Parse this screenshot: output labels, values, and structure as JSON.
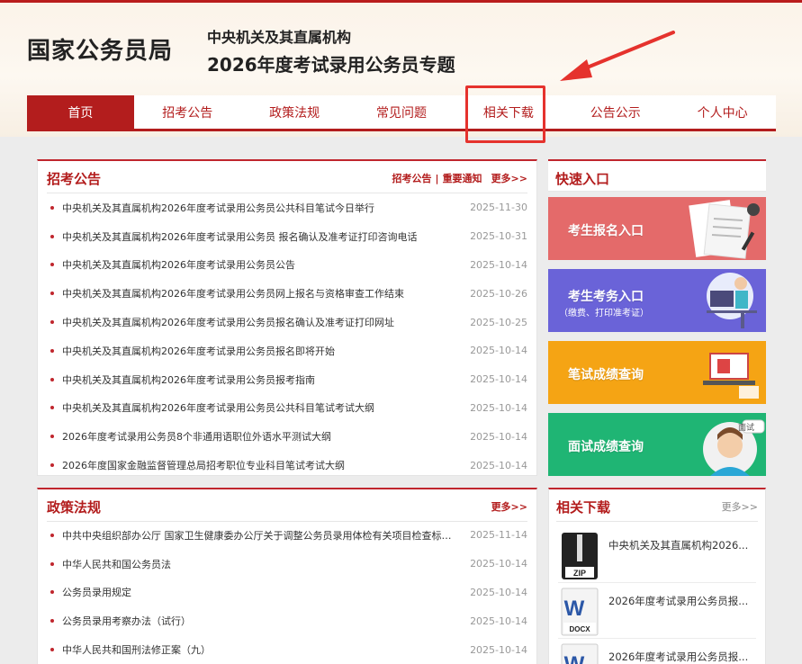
{
  "header": {
    "logo": "国家公务员局",
    "subtitle_line1": "中央机关及其直属机构",
    "subtitle_line2": "2026年度考试录用公务员专题"
  },
  "nav": {
    "items": [
      {
        "label": "首页",
        "active": true
      },
      {
        "label": "招考公告"
      },
      {
        "label": "政策法规"
      },
      {
        "label": "常见问题"
      },
      {
        "label": "相关下载"
      },
      {
        "label": "公告公示"
      },
      {
        "label": "个人中心"
      }
    ]
  },
  "announcements": {
    "title": "招考公告",
    "link1": "招考公告",
    "separator": "|",
    "link2": "重要通知",
    "more": "更多>>",
    "items": [
      {
        "title": "中央机关及其直属机构2026年度考试录用公务员公共科目笔试今日举行",
        "date": "2025-11-30"
      },
      {
        "title": "中央机关及其直属机构2026年度考试录用公务员 报名确认及准考证打印咨询电话",
        "date": "2025-10-31"
      },
      {
        "title": "中央机关及其直属机构2026年度考试录用公务员公告",
        "date": "2025-10-14"
      },
      {
        "title": "中央机关及其直属机构2026年度考试录用公务员网上报名与资格审查工作结束",
        "date": "2025-10-26"
      },
      {
        "title": "中央机关及其直属机构2026年度考试录用公务员报名确认及准考证打印网址",
        "date": "2025-10-25"
      },
      {
        "title": "中央机关及其直属机构2026年度考试录用公务员报名即将开始",
        "date": "2025-10-14"
      },
      {
        "title": "中央机关及其直属机构2026年度考试录用公务员报考指南",
        "date": "2025-10-14"
      },
      {
        "title": "中央机关及其直属机构2026年度考试录用公务员公共科目笔试考试大纲",
        "date": "2025-10-14"
      },
      {
        "title": "2026年度考试录用公务员8个非通用语职位外语水平测试大纲",
        "date": "2025-10-14"
      },
      {
        "title": "2026年度国家金融监督管理总局招考职位专业科目笔试考试大纲",
        "date": "2025-10-14"
      }
    ]
  },
  "policies": {
    "title": "政策法规",
    "more": "更多>>",
    "items": [
      {
        "title": "中共中央组织部办公厅 国家卫生健康委办公厅关于调整公务员录用体检有关项目检查标准...",
        "date": "2025-11-14"
      },
      {
        "title": "中华人民共和国公务员法",
        "date": "2025-10-14"
      },
      {
        "title": "公务员录用规定",
        "date": "2025-10-14"
      },
      {
        "title": "公务员录用考察办法（试行）",
        "date": "2025-10-14"
      },
      {
        "title": "中华人民共和国刑法修正案（九）",
        "date": "2025-10-14"
      }
    ]
  },
  "quick_entry": {
    "title": "快速入口",
    "cards": [
      {
        "label": "考生报名入口",
        "color": "#e46a6a"
      },
      {
        "label": "考生考务入口",
        "sub": "（缴费、打印准考证）",
        "color": "#6a63d8"
      },
      {
        "label": "笔试成绩查询",
        "color": "#f5a414"
      },
      {
        "label": "面试成绩查询",
        "badge": "面试",
        "color": "#1fb574"
      }
    ]
  },
  "downloads": {
    "title": "相关下载",
    "more": "更多>>",
    "items": [
      {
        "title": "中央机关及其直属机构2026...",
        "type": "ZIP"
      },
      {
        "title": "2026年度考试录用公务员报...",
        "type": "DOCX"
      },
      {
        "title": "2026年度考试录用公务员报...",
        "type": "DOCX"
      }
    ]
  }
}
